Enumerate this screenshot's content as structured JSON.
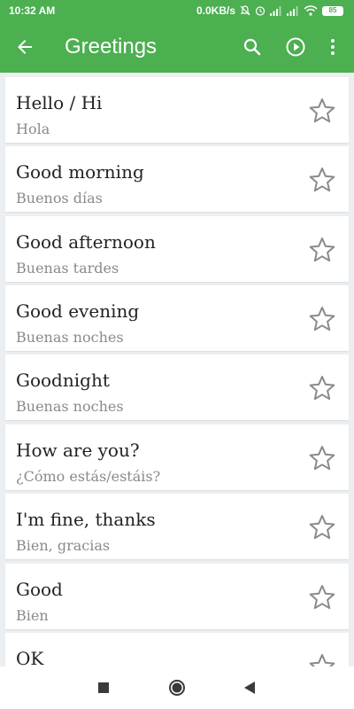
{
  "status_bar": {
    "time": "10:32 AM",
    "network_speed": "0.0KB/s",
    "battery_level": "85",
    "icons": [
      "mute-icon",
      "alarm-icon",
      "signal-icon",
      "signal-icon",
      "wifi-icon",
      "battery-icon"
    ]
  },
  "app_bar": {
    "title": "Greetings",
    "icons": [
      "back-arrow-icon",
      "search-icon",
      "play-icon",
      "more-vert-icon"
    ]
  },
  "phrases": [
    {
      "phrase": "Hello / Hi",
      "translation": "Hola"
    },
    {
      "phrase": "Good morning",
      "translation": "Buenos días"
    },
    {
      "phrase": "Good afternoon",
      "translation": "Buenas tardes"
    },
    {
      "phrase": "Good evening",
      "translation": "Buenas noches"
    },
    {
      "phrase": "Goodnight",
      "translation": "Buenas noches"
    },
    {
      "phrase": "How are you?",
      "translation": "¿Cómo estás/estáis?"
    },
    {
      "phrase": "I'm fine, thanks",
      "translation": "Bien, gracias"
    },
    {
      "phrase": "Good",
      "translation": "Bien"
    },
    {
      "phrase": "OK",
      "translation": ""
    }
  ],
  "nav_bar": {
    "icons": [
      "recent-apps-icon",
      "home-icon",
      "back-icon"
    ]
  },
  "colors": {
    "accent": "#4caf50",
    "background": "#eceff1",
    "card": "#ffffff",
    "phrase_text": "#222222",
    "translation_text": "#8a8a8a",
    "star_outline": "#8a8a8a"
  }
}
